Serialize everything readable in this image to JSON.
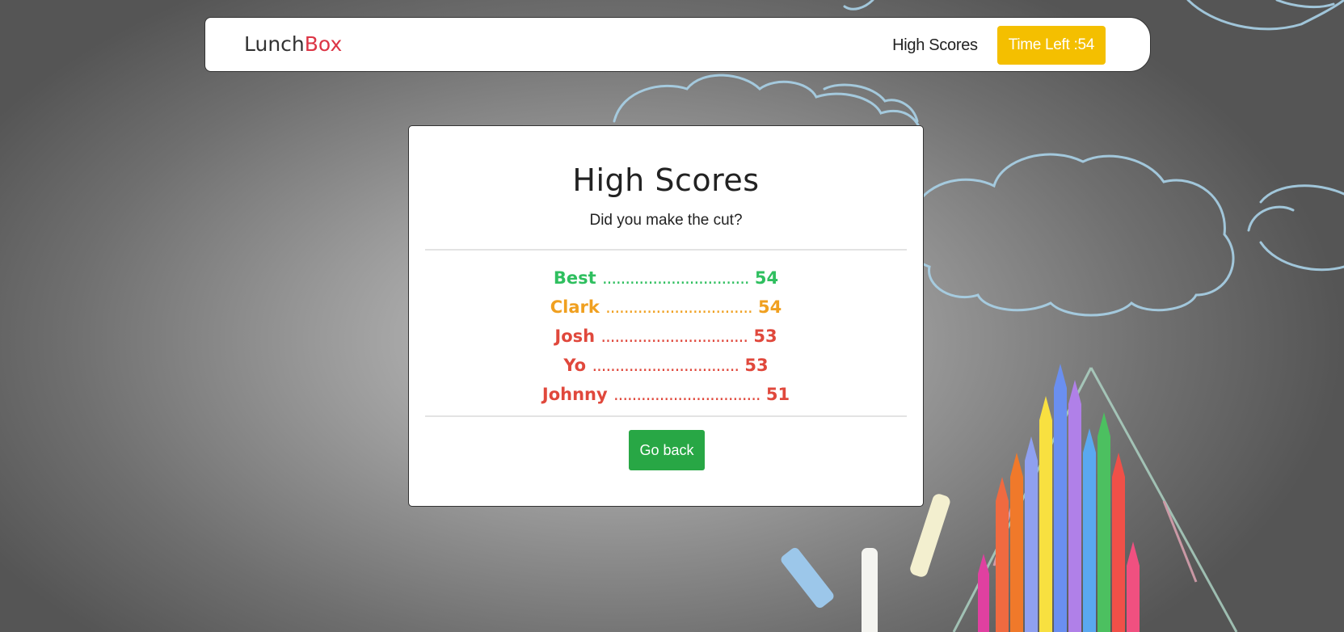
{
  "nav": {
    "brand_part1": "Lunch",
    "brand_part2": "Box",
    "high_scores_link": "High Scores",
    "timer_text": "Time Left :54"
  },
  "card": {
    "title": "High Scores",
    "subtitle": "Did you make the cut?",
    "scores": [
      {
        "name": "Best",
        "dots": "................................",
        "score": "54",
        "color": "#2fbf5f"
      },
      {
        "name": "Clark",
        "dots": "................................",
        "score": "54",
        "color": "#f0a020"
      },
      {
        "name": "Josh",
        "dots": "................................",
        "score": "53",
        "color": "#e0483c"
      },
      {
        "name": "Yo",
        "dots": "................................",
        "score": "53",
        "color": "#e0483c"
      },
      {
        "name": "Johnny",
        "dots": "................................",
        "score": "51",
        "color": "#e0483c"
      }
    ],
    "go_back_label": "Go back"
  },
  "colors": {
    "brand_accent": "#dc3545",
    "timer_bg": "#f4bf00",
    "button_bg": "#28a745"
  }
}
